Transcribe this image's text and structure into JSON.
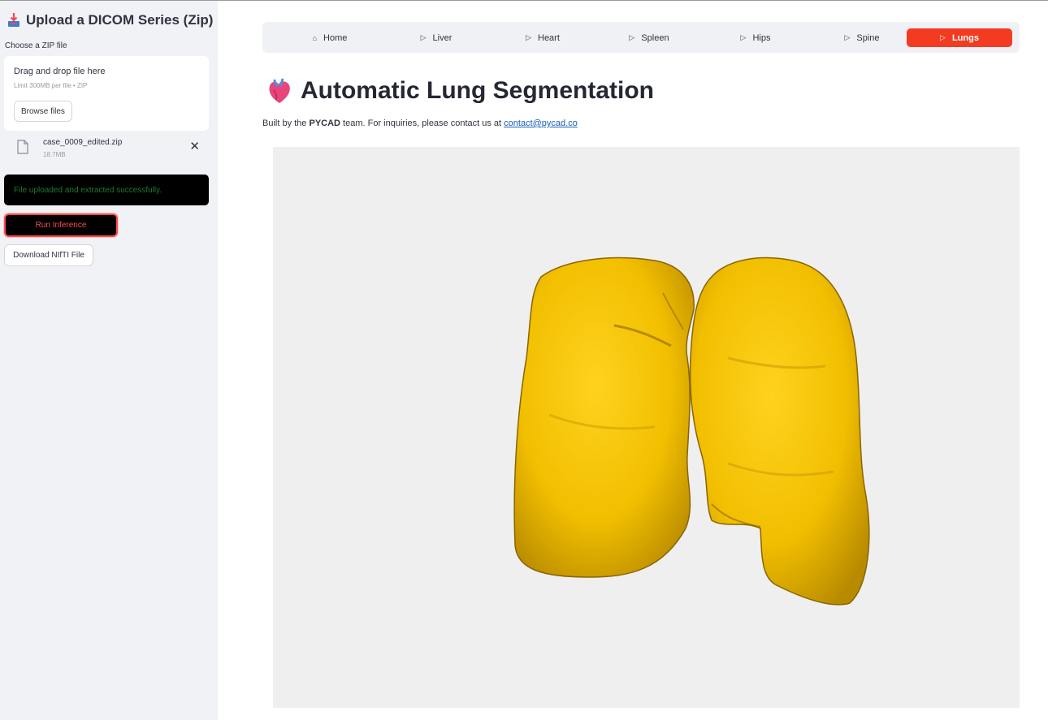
{
  "sidebar": {
    "title": "Upload a DICOM Series (Zip)",
    "title_icon": "inbox-tray-icon",
    "uploader_label": "Choose a ZIP file",
    "dropzone_text": "Drag and drop file here",
    "dropzone_limit": "Limit 300MB per file • ZIP",
    "browse_label": "Browse files",
    "file": {
      "name": "case_0009_edited.zip",
      "size": "18.7MB"
    },
    "success_message": "File uploaded and extracted successfully.",
    "run_label": "Run Inference",
    "download_label": "Download NIfTI File"
  },
  "nav": {
    "items": [
      {
        "label": "Home",
        "icon": "house-icon"
      },
      {
        "label": "Liver",
        "icon": "play-icon"
      },
      {
        "label": "Heart",
        "icon": "play-icon"
      },
      {
        "label": "Spleen",
        "icon": "play-icon"
      },
      {
        "label": "Hips",
        "icon": "play-icon"
      },
      {
        "label": "Spine",
        "icon": "play-icon"
      },
      {
        "label": "Lungs",
        "icon": "play-icon"
      }
    ],
    "active": "Lungs",
    "active_color": "#f33b22"
  },
  "main": {
    "title": "Automatic Lung Segmentation",
    "title_icon": "anatomical-heart-icon",
    "byline_prefix": "Built by the ",
    "byline_team": "PYCAD",
    "byline_middle": " team. For inquiries, please contact us at ",
    "byline_email": "contact@pycad.co",
    "viewer": {
      "content": "3d-lung-mesh",
      "mesh_color": "#f5c200",
      "background": "#efefef"
    }
  }
}
